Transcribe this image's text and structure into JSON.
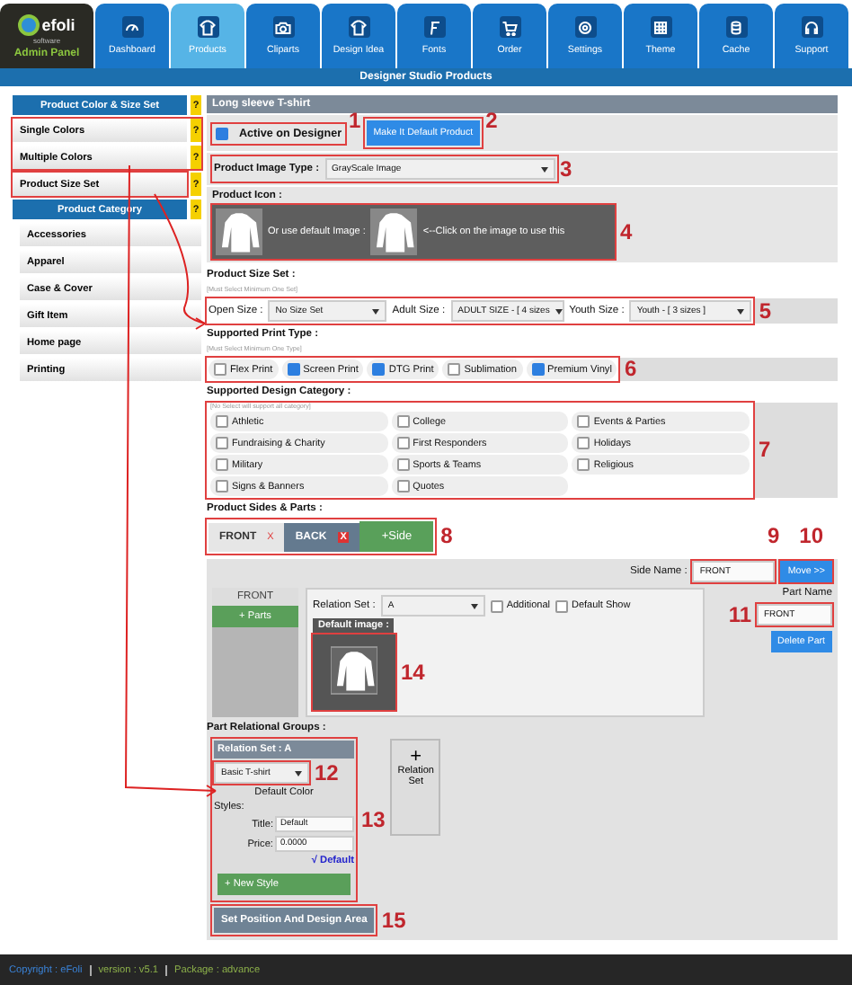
{
  "logo": {
    "brand": "efoli",
    "sub": "software",
    "caption": "Admin Panel"
  },
  "nav": [
    {
      "label": "Dashboard",
      "selected": false
    },
    {
      "label": "Products",
      "selected": true
    },
    {
      "label": "Cliparts",
      "selected": false
    },
    {
      "label": "Design Idea",
      "selected": false
    },
    {
      "label": "Fonts",
      "selected": false
    },
    {
      "label": "Order",
      "selected": false
    },
    {
      "label": "Settings",
      "selected": false
    },
    {
      "label": "Theme",
      "selected": false
    },
    {
      "label": "Cache",
      "selected": false
    },
    {
      "label": "Support",
      "selected": false
    }
  ],
  "banner": "Designer Studio Products",
  "sidebar": [
    {
      "title": "Product Color & Size Set",
      "help": "?",
      "items": [
        {
          "label": "Single Colors",
          "help": "?"
        },
        {
          "label": "Multiple Colors",
          "help": "?"
        },
        {
          "label": "Product Size Set",
          "help": "?"
        }
      ]
    },
    {
      "title": "Product Category",
      "help": "?",
      "items": [
        {
          "label": "Accessories"
        },
        {
          "label": "Apparel"
        },
        {
          "label": "Case & Cover"
        },
        {
          "label": "Gift Item"
        },
        {
          "label": "Home page"
        },
        {
          "label": "Printing"
        }
      ]
    }
  ],
  "product": {
    "title": "Long sleeve T-shirt",
    "active": {
      "label": "Active on Designer",
      "checked": true
    },
    "default_button": "Make It Default Product",
    "image_type": {
      "label": "Product Image Type :",
      "value": "GrayScale Image"
    },
    "icon": {
      "label": "Product Icon :",
      "middle": "Or use default Image :",
      "hint": "<--Click on the image to use this"
    },
    "size_set": {
      "label": "Product Size Set :",
      "hint": "[Must Select Minimum One Set]",
      "selects": [
        {
          "label": "Open Size :",
          "value": "No Size Set"
        },
        {
          "label": "Adult Size :",
          "value": "ADULT SIZE - [ 4 sizes"
        },
        {
          "label": "Youth Size :",
          "value": "Youth - [ 3 sizes ]"
        }
      ]
    },
    "print_types": {
      "label": "Supported Print Type :",
      "hint": "[Must Select Minimum One Type]",
      "options": [
        {
          "label": "Flex Print",
          "checked": false
        },
        {
          "label": "Screen Print",
          "checked": true
        },
        {
          "label": "DTG Print",
          "checked": true
        },
        {
          "label": "Sublimation",
          "checked": false
        },
        {
          "label": "Premium Vinyl",
          "checked": true
        }
      ]
    },
    "design_categories": {
      "label": "Supported Design Category :",
      "hint": "[No Select will support all category]",
      "options": [
        {
          "label": "Athletic",
          "checked": false
        },
        {
          "label": "College",
          "checked": false
        },
        {
          "label": "Events & Parties",
          "checked": false
        },
        {
          "label": "Fundraising & Charity",
          "checked": false
        },
        {
          "label": "First Responders",
          "checked": false
        },
        {
          "label": "Holidays",
          "checked": false
        },
        {
          "label": "Military",
          "checked": false
        },
        {
          "label": "Sports & Teams",
          "checked": false
        },
        {
          "label": "Religious",
          "checked": false
        },
        {
          "label": "Signs & Banners",
          "checked": false
        },
        {
          "label": "Quotes",
          "checked": false
        }
      ]
    },
    "sides": {
      "label": "Product Sides & Parts :",
      "tabs": [
        {
          "label": "FRONT",
          "close": "X",
          "selected": true
        },
        {
          "label": "BACK",
          "close": "X",
          "selected": false
        }
      ],
      "add": "+Side",
      "side_name": {
        "label": "Side Name :",
        "value": "FRONT"
      },
      "move": "Move >>"
    },
    "parts": {
      "side": "FRONT",
      "add_parts": "+ Parts",
      "relation": {
        "label": "Relation Set :",
        "value": "A"
      },
      "additional": {
        "label": "Additional",
        "checked": false
      },
      "default_show": {
        "label": "Default Show",
        "checked": false
      },
      "default_image": "Default image :",
      "part_name": {
        "label": "Part Name",
        "value": "FRONT"
      },
      "delete": "Delete Part"
    },
    "groups": {
      "label": "Part Relational Groups :",
      "set": {
        "title": "Relation Set : A",
        "value": "Basic T-shirt",
        "color_label": "Default Color",
        "styles": "Styles:",
        "title_field": {
          "label": "Title:",
          "value": "Default"
        },
        "price": {
          "label": "Price:",
          "value": "0.0000"
        },
        "default": "√ Default",
        "new_style": "+ New Style"
      },
      "add": {
        "plus": "+",
        "label": "Relation Set"
      }
    },
    "set_position": "Set Position And Design Area"
  },
  "annotations": [
    "1",
    "2",
    "3",
    "4",
    "5",
    "6",
    "7",
    "8",
    "9",
    "10",
    "11",
    "12",
    "13",
    "14",
    "15"
  ],
  "footer": [
    {
      "kind": "copyright",
      "text": "Copyright : eFoli"
    },
    {
      "kind": "info",
      "text": "version : v5.1"
    },
    {
      "kind": "package",
      "text": "Package : advance"
    }
  ]
}
